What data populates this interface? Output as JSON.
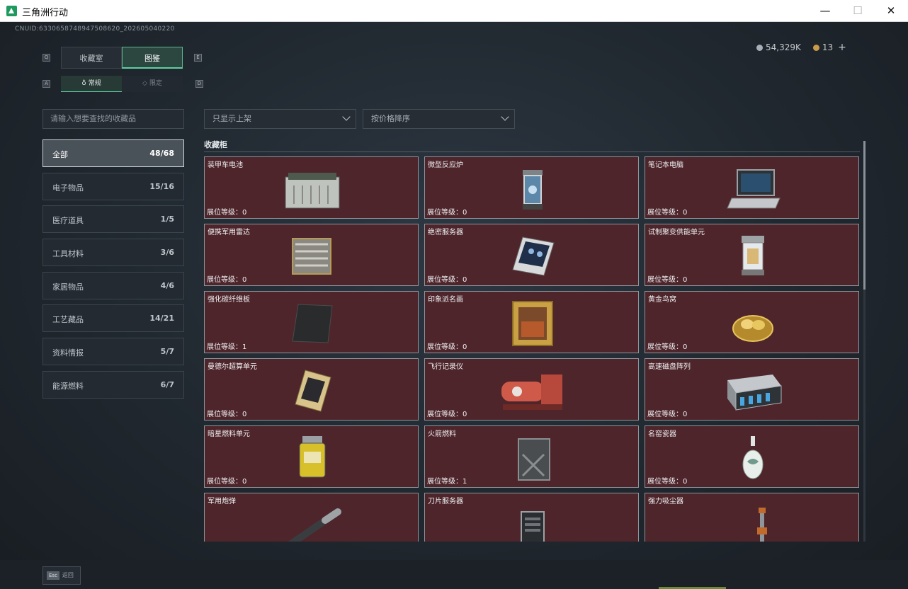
{
  "window": {
    "title": "三角洲行动",
    "min_glyph": "—",
    "max_glyph": "☐",
    "close_glyph": "✕"
  },
  "header": {
    "uid": "CNUID:633065874894750862​0_202605040220",
    "silver": "54,329K",
    "gold": "13",
    "plus": "+"
  },
  "keys": {
    "q": "Q",
    "e": "E",
    "a": "A",
    "d": "D"
  },
  "tabs": {
    "collection": "收藏室",
    "atlas": "图鉴"
  },
  "subtabs": {
    "normal": "常规",
    "limited": "限定"
  },
  "search": {
    "placeholder": "请输入想要查找的收藏品"
  },
  "filters": {
    "shelf": "只显示上架",
    "sort": "按价格降序"
  },
  "categories": [
    {
      "name": "全部",
      "count": "48/68"
    },
    {
      "name": "电子物品",
      "count": "15/16"
    },
    {
      "name": "医疗道具",
      "count": "1/5"
    },
    {
      "name": "工具材料",
      "count": "3/6"
    },
    {
      "name": "家居物品",
      "count": "4/6"
    },
    {
      "name": "工艺藏品",
      "count": "14/21"
    },
    {
      "name": "资料情报",
      "count": "5/7"
    },
    {
      "name": "能源燃料",
      "count": "6/7"
    }
  ],
  "section": {
    "title": "收藏柜"
  },
  "level_label": "展位等级：",
  "items": [
    {
      "name": "装甲车电池",
      "level": "0",
      "icon": "battery-icon"
    },
    {
      "name": "微型反应炉",
      "level": "0",
      "icon": "reactor-icon"
    },
    {
      "name": "笔记本电脑",
      "level": "0",
      "icon": "laptop-icon"
    },
    {
      "name": "便携军用雷达",
      "level": "0",
      "icon": "radar-icon"
    },
    {
      "name": "绝密服务器",
      "level": "0",
      "icon": "server-board-icon"
    },
    {
      "name": "试制聚变供能单元",
      "level": "0",
      "icon": "fusion-unit-icon"
    },
    {
      "name": "强化碳纤维板",
      "level": "1",
      "icon": "carbon-plate-icon"
    },
    {
      "name": "印象派名画",
      "level": "0",
      "icon": "painting-icon"
    },
    {
      "name": "黄金鸟窝",
      "level": "0",
      "icon": "golden-nest-icon"
    },
    {
      "name": "曼德尔超算单元",
      "level": "0",
      "icon": "supercompute-icon"
    },
    {
      "name": "飞行记录仪",
      "level": "0",
      "icon": "flight-recorder-icon"
    },
    {
      "name": "高速磁盘阵列",
      "level": "0",
      "icon": "disk-array-icon"
    },
    {
      "name": "暗星燃料单元",
      "level": "0",
      "icon": "fuel-cell-icon"
    },
    {
      "name": "火箭燃料",
      "level": "1",
      "icon": "jerrycan-icon"
    },
    {
      "name": "名窑瓷器",
      "level": "0",
      "icon": "porcelain-vase-icon"
    },
    {
      "name": "军用炮弹",
      "level": "",
      "icon": "artillery-shell-icon"
    },
    {
      "name": "刀片服务器",
      "level": "",
      "icon": "blade-server-icon"
    },
    {
      "name": "强力吸尘器",
      "level": "",
      "icon": "vacuum-icon"
    }
  ],
  "footer": {
    "esc_key": "Esc",
    "esc_label": "返回"
  }
}
